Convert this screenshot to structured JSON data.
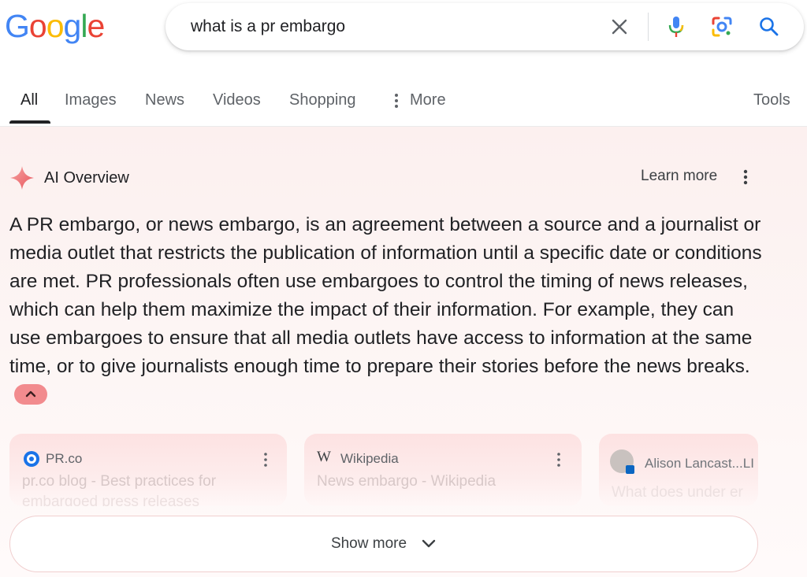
{
  "brand": {
    "logo_letters": [
      {
        "ch": "G",
        "color": "#4285F4"
      },
      {
        "ch": "o",
        "color": "#EA4335"
      },
      {
        "ch": "o",
        "color": "#FBBC05"
      },
      {
        "ch": "g",
        "color": "#4285F4"
      },
      {
        "ch": "l",
        "color": "#34A853"
      },
      {
        "ch": "e",
        "color": "#EA4335"
      }
    ]
  },
  "search": {
    "query": "what is a pr embargo",
    "icons": [
      "close-icon",
      "microphone-icon",
      "lens-icon",
      "search-icon"
    ]
  },
  "tabs": [
    {
      "label": "All",
      "active": true
    },
    {
      "label": "Images"
    },
    {
      "label": "News"
    },
    {
      "label": "Videos"
    },
    {
      "label": "Shopping"
    },
    {
      "label": "More",
      "icon": "kebab-icon"
    }
  ],
  "tools_label": "Tools",
  "ai_overview": {
    "title": "AI Overview",
    "learn_more": "Learn more",
    "body": "A PR embargo, or news embargo, is an agreement between a source and a journalist or media outlet that restricts the publication of information until a specific date or conditions are met. PR professionals often use embargoes to control the timing of news releases, which can help them maximize the impact of their information. For example, they can use embargoes to ensure that all media outlets have access to information at the same time, or to give journalists enough time to prepare their stories before the news breaks.",
    "accent_color": "#f28b8e"
  },
  "sources": [
    {
      "name": "PR.co",
      "title": "pr.co blog - Best practices for",
      "subtitle": "embargoed press releases"
    },
    {
      "name": "Wikipedia",
      "title": "News embargo - Wikipedia",
      "subtitle": ""
    },
    {
      "name": "Alison Lancast...LI",
      "title": "What does under er",
      "subtitle": ""
    }
  ],
  "show_more_label": "Show more"
}
